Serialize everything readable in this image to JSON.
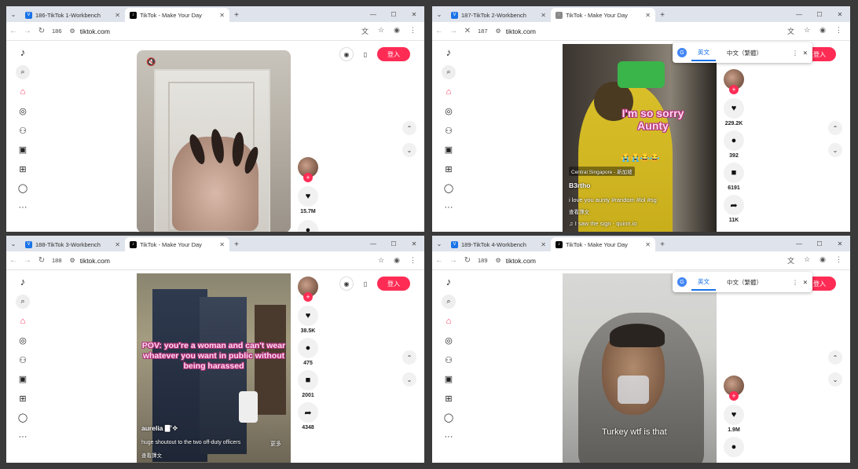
{
  "windows": [
    {
      "tabs": [
        {
          "title": "186-TikTok 1-Workbench",
          "fav": "V"
        },
        {
          "title": "TikTok - Make Your Day",
          "fav": "♪"
        }
      ],
      "active_tab": 1,
      "tab_number": "186",
      "url": "tiktok.com",
      "login": "登入",
      "new_tab_symbol": "+",
      "video": {
        "mute_icon": "🔇"
      },
      "actions": {
        "likes": "15.7M"
      }
    },
    {
      "tabs": [
        {
          "title": "187-TikTok 2-Workbench",
          "fav": "V"
        },
        {
          "title": "TikTok - Make Your Day",
          "fav": "◌"
        }
      ],
      "active_tab": 1,
      "tab_number": "187",
      "url": "tiktok.com",
      "login": "登入",
      "translate": {
        "lang1": "英文",
        "lang2": "中文（繁體）"
      },
      "video": {
        "overlay": "I'm so sorry Aunty",
        "emoji": "😭😭😂😂",
        "location": "Central Singapore - 新加坡",
        "author": "B3rtho",
        "caption": "i love you aunty #random #lol #sg",
        "see_translation": "查看譯文",
        "sound": "♫  I saw the sign - quinn.io"
      },
      "actions": {
        "likes": "229.2K",
        "comments": "392",
        "saves": "6191",
        "shares": "11K"
      }
    },
    {
      "tabs": [
        {
          "title": "188-TikTok 3-Workbench",
          "fav": "V"
        },
        {
          "title": "TikTok - Make Your Day",
          "fav": "♪"
        }
      ],
      "active_tab": 1,
      "tab_number": "188",
      "url": "tiktok.com",
      "login": "登入",
      "video": {
        "overlay": "POV: you're a woman and can't wear whatever you want in public without being harassed",
        "author": "aurelia 🀫˚✧",
        "caption": "huge shoutout to the two off-duty officers",
        "more": "更多",
        "see_translation": "查看譯文"
      },
      "actions": {
        "likes": "38.5K",
        "comments": "475",
        "saves": "2001",
        "shares": "4348"
      }
    },
    {
      "tabs": [
        {
          "title": "189-TikTok 4-Workbench",
          "fav": "V"
        },
        {
          "title": "TikTok - Make Your Day",
          "fav": "♪"
        }
      ],
      "active_tab": 1,
      "tab_number": "189",
      "url": "tiktok.com",
      "login": "登入",
      "translate": {
        "lang1": "英文",
        "lang2": "中文（繁體）"
      },
      "video": {
        "overlay": "Turkey wtf is that"
      },
      "actions": {
        "likes": "1.9M"
      }
    }
  ],
  "icons": {
    "logo": "♪",
    "search": "⌕",
    "home": "⌂",
    "explore": "◎",
    "following": "⚇",
    "live": "▣",
    "upload": "⊞",
    "profile": "◯",
    "more": "···",
    "heart": "♥",
    "comment": "●",
    "bookmark": "■",
    "share": "➦",
    "up": "⌃",
    "down": "⌄"
  },
  "colors": {
    "brand": "#fe2c55",
    "chrome_tab": "#dfe3eb",
    "link": "#1a73e8"
  }
}
